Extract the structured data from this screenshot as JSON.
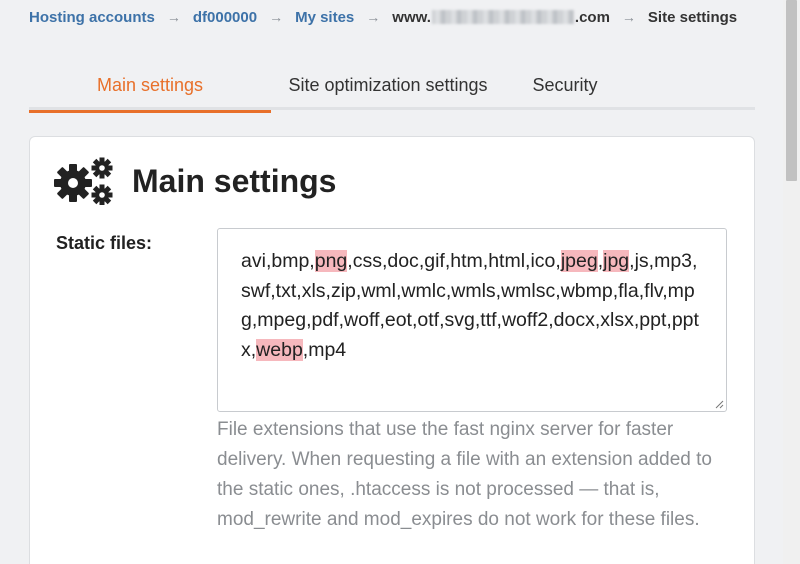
{
  "breadcrumb": {
    "items": [
      "Hosting accounts",
      "df000000",
      "My sites"
    ],
    "domain_prefix": "www.",
    "domain_suffix": ".com",
    "current": "Site settings",
    "separator": "→"
  },
  "tabs": [
    {
      "label": "Main settings",
      "active": true
    },
    {
      "label": "Site optimization settings",
      "active": false
    },
    {
      "label": "Security",
      "active": false
    }
  ],
  "card": {
    "title": "Main settings",
    "icon": "gears-icon",
    "static_files": {
      "label": "Static files:",
      "value": "avi,bmp,png,css,doc,gif,htm,html,ico,jpeg,jpg,js,mp3,swf,txt,xls,zip,wml,wmlc,wmls,wmlsc,wbmp,fla,flv,mpg,mpeg,pdf,woff,eot,otf,svg,ttf,woff2,docx,xlsx,ppt,pptx,webp,mp4",
      "highlighted": [
        "png",
        "jpeg",
        "jpg",
        "webp"
      ],
      "help": "File extensions that use the fast nginx server for faster delivery. When requesting a file with an extension added to the static ones, .htaccess is not processed — that is, mod_rewrite and mod_expires do not work for these files."
    }
  },
  "colors": {
    "accent": "#e8702a",
    "link": "#3d72a8",
    "highlight": "#f6b8bd",
    "background": "#f0f1f3"
  }
}
